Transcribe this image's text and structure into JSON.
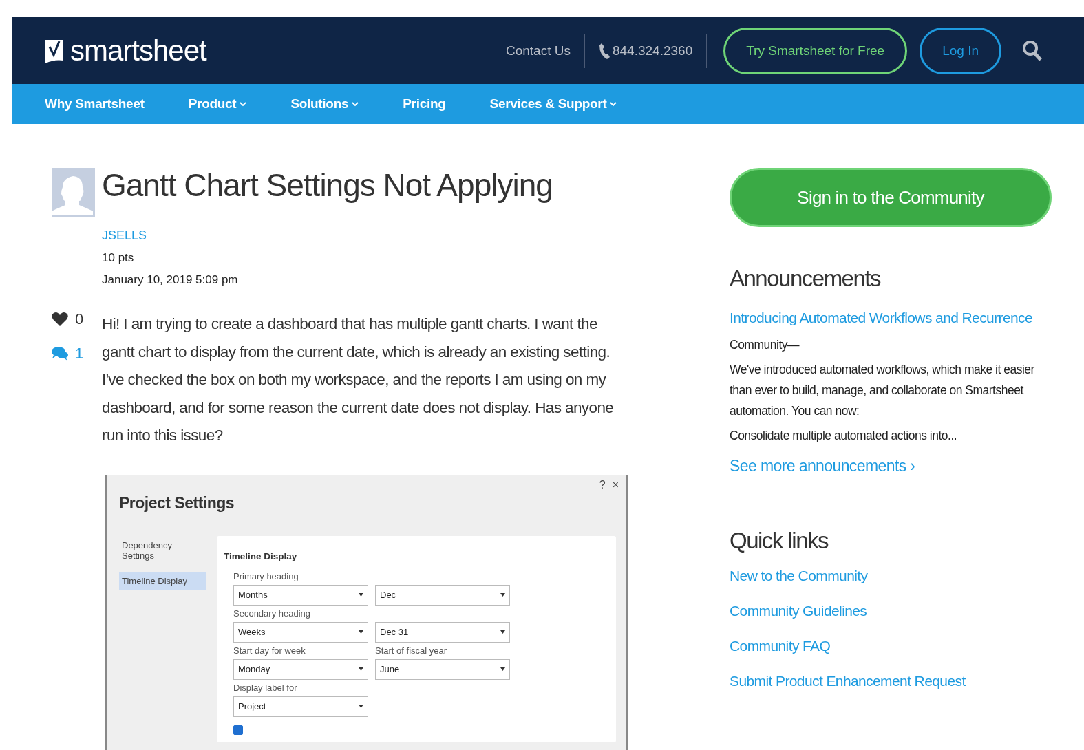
{
  "header": {
    "logo": "smartsheet",
    "contact": "Contact Us",
    "phone": "844.324.2360",
    "try_button": "Try Smartsheet for Free",
    "login_button": "Log In"
  },
  "nav": [
    {
      "label": "Why Smartsheet",
      "dropdown": false
    },
    {
      "label": "Product",
      "dropdown": true
    },
    {
      "label": "Solutions",
      "dropdown": true
    },
    {
      "label": "Pricing",
      "dropdown": false
    },
    {
      "label": "Services & Support",
      "dropdown": true
    }
  ],
  "post": {
    "title": "Gantt Chart Settings Not Applying",
    "author": "JSELLS",
    "points": "10 pts",
    "date": "January 10, 2019 5:09 pm",
    "likes": "0",
    "comments": "1",
    "body": "Hi! I am trying to create a dashboard that has multiple gantt charts. I want the gantt chart to display from the current date, which is already an existing setting. I've checked the box on both my workspace, and the reports I am using on my dashboard, and for some reason the current date does not display. Has anyone run into this issue?",
    "screenshot": {
      "title": "Project Settings",
      "help": "?",
      "close": "×",
      "side_items": [
        {
          "label": "Dependency Settings",
          "selected": false
        },
        {
          "label": "Timeline Display",
          "selected": true
        }
      ],
      "section": "Timeline Display",
      "rows": [
        {
          "label": "Primary heading",
          "selects": [
            {
              "value": "Months"
            },
            {
              "value": "Dec"
            }
          ]
        },
        {
          "label": "Secondary heading",
          "selects": [
            {
              "value": "Weeks"
            },
            {
              "value": "Dec 31"
            }
          ]
        },
        {
          "label": "Start day for week",
          "label_2": "Start of fiscal year",
          "selects": [
            {
              "value": "Monday"
            },
            {
              "value": "June"
            }
          ]
        },
        {
          "label": "Display label for",
          "selects": [
            {
              "value": "Project"
            }
          ]
        }
      ],
      "open_today_checked": true
    }
  },
  "sidebar": {
    "signin_button": "Sign in to the Community",
    "announcements": {
      "heading": "Announcements",
      "link": "Introducing Automated Workflows and Recurrence",
      "paragraphs": [
        "Community—",
        "We've introduced automated workflows, which make it easier than ever to build, manage, and collaborate on Smartsheet automation. You can now:",
        "Consolidate multiple automated actions into..."
      ],
      "more": "See more announcements ›"
    },
    "quick_links": {
      "heading": "Quick links",
      "links": [
        "New to the Community",
        "Community Guidelines",
        "Community FAQ",
        "Submit Product Enhancement Request"
      ]
    }
  }
}
